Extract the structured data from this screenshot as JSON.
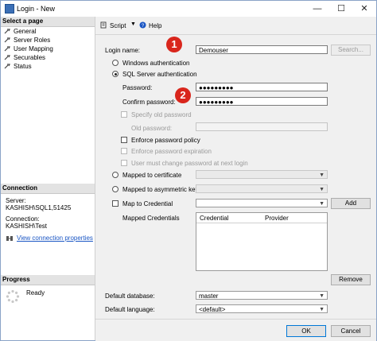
{
  "window": {
    "title": "Login - New"
  },
  "sidebar": {
    "header": "Select a page",
    "items": [
      {
        "label": "General"
      },
      {
        "label": "Server Roles"
      },
      {
        "label": "User Mapping"
      },
      {
        "label": "Securables"
      },
      {
        "label": "Status"
      }
    ],
    "connection": {
      "header": "Connection",
      "server_label": "Server:",
      "server_value": "KASHISH\\SQL1,51425",
      "connection_label": "Connection:",
      "connection_value": "KASHISH\\Test",
      "view_link": "View connection properties"
    },
    "progress": {
      "header": "Progress",
      "status": "Ready"
    }
  },
  "toolbar": {
    "script_label": "Script",
    "help_label": "Help"
  },
  "form": {
    "login_name_label": "Login name:",
    "login_name_value": "Demouser",
    "search_button": "Search...",
    "windows_auth": "Windows authentication",
    "sql_auth": "SQL Server authentication",
    "password_label": "Password:",
    "password_value": "●●●●●●●●●",
    "confirm_password_label": "Confirm password:",
    "confirm_password_value": "●●●●●●●●●",
    "specify_old_password": "Specify old password",
    "old_password_label": "Old password:",
    "enforce_policy": "Enforce password policy",
    "enforce_expiration": "Enforce password expiration",
    "must_change": "User must change password at next login",
    "mapped_certificate": "Mapped to certificate",
    "mapped_asym_key": "Mapped to asymmetric key",
    "map_credential": "Map to Credential",
    "add_button": "Add",
    "mapped_credentials_label": "Mapped Credentials",
    "credential_col": "Credential",
    "provider_col": "Provider",
    "remove_button": "Remove",
    "default_db_label": "Default database:",
    "default_db_value": "master",
    "default_lang_label": "Default language:",
    "default_lang_value": "<default>"
  },
  "annotations": {
    "badge1": "1",
    "badge2": "2"
  },
  "footer": {
    "ok_button": "OK",
    "cancel_button": "Cancel"
  },
  "colors": {
    "accent": "#1a56c4",
    "badge": "#d9261c"
  }
}
